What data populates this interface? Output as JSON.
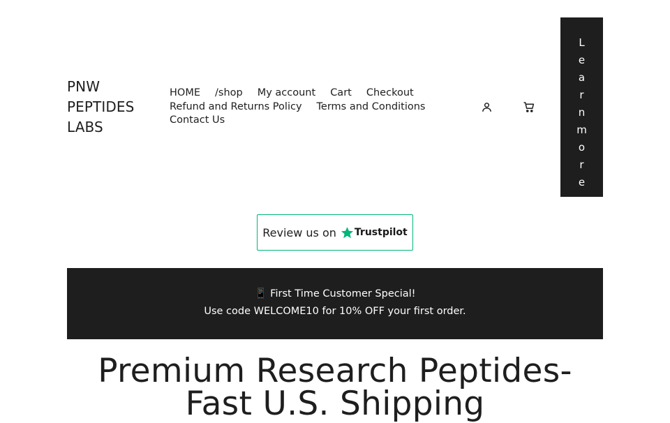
{
  "site": {
    "title_lines": [
      "PNW",
      "PEPTIDES",
      "LABS"
    ]
  },
  "nav": {
    "items": [
      {
        "label": "HOME"
      },
      {
        "label": "/shop"
      },
      {
        "label": "My account"
      },
      {
        "label": "Cart"
      },
      {
        "label": "Checkout"
      },
      {
        "label": "Refund and Returns Policy"
      },
      {
        "label": "Terms and Conditions"
      },
      {
        "label": "Contact Us"
      }
    ]
  },
  "header_icons": {
    "account": "user-icon",
    "cart": "cart-icon"
  },
  "learn_more": {
    "label": "Learn more",
    "letters": [
      "L",
      "e",
      "a",
      "r",
      "n",
      "m",
      "o",
      "r",
      "e"
    ]
  },
  "trustpilot": {
    "prefix": "Review us on",
    "brand": "Trustpilot",
    "star_color": "#00b67a"
  },
  "banner": {
    "icon": "📱",
    "headline": "First Time Customer Special!",
    "offer": "Use code WELCOME10 for 10% OFF your first order."
  },
  "hero": {
    "title": "Premium Research Peptides- Fast U.S. Shipping"
  },
  "colors": {
    "dark": "#1e1e1e",
    "accent": "#00b67a",
    "background": "#ffffff"
  }
}
